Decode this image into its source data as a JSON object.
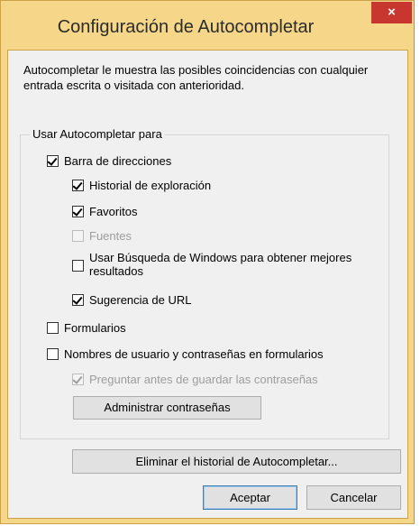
{
  "window": {
    "title": "Configuración de Autocompletar",
    "close_glyph": "×"
  },
  "description": "Autocompletar le muestra las posibles coincidencias con cualquier entrada escrita o visitada con anterioridad.",
  "group": {
    "legend": "Usar Autocompletar para",
    "options": [
      {
        "label": "Barra de direcciones",
        "checked": true,
        "enabled": true
      },
      {
        "label": "Historial de exploración",
        "checked": true,
        "enabled": true
      },
      {
        "label": "Favoritos",
        "checked": true,
        "enabled": true
      },
      {
        "label": "Fuentes",
        "checked": false,
        "enabled": false
      },
      {
        "label": "Usar Búsqueda de Windows para obtener mejores resultados",
        "checked": false,
        "enabled": true
      },
      {
        "label": "Sugerencia de URL",
        "checked": true,
        "enabled": true
      },
      {
        "label": "Formularios",
        "checked": false,
        "enabled": true
      },
      {
        "label": "Nombres de usuario y contraseñas en formularios",
        "checked": false,
        "enabled": true
      },
      {
        "label": "Preguntar antes de guardar las contraseñas",
        "checked": true,
        "enabled": false
      }
    ],
    "manage_passwords_button": "Administrar contraseñas"
  },
  "buttons": {
    "delete_history": "Eliminar el historial de Autocompletar...",
    "accept": "Aceptar",
    "cancel": "Cancelar"
  },
  "colors": {
    "frame": "#f6d789",
    "close": "#c7372f",
    "default_button": "#3c7fb1"
  }
}
